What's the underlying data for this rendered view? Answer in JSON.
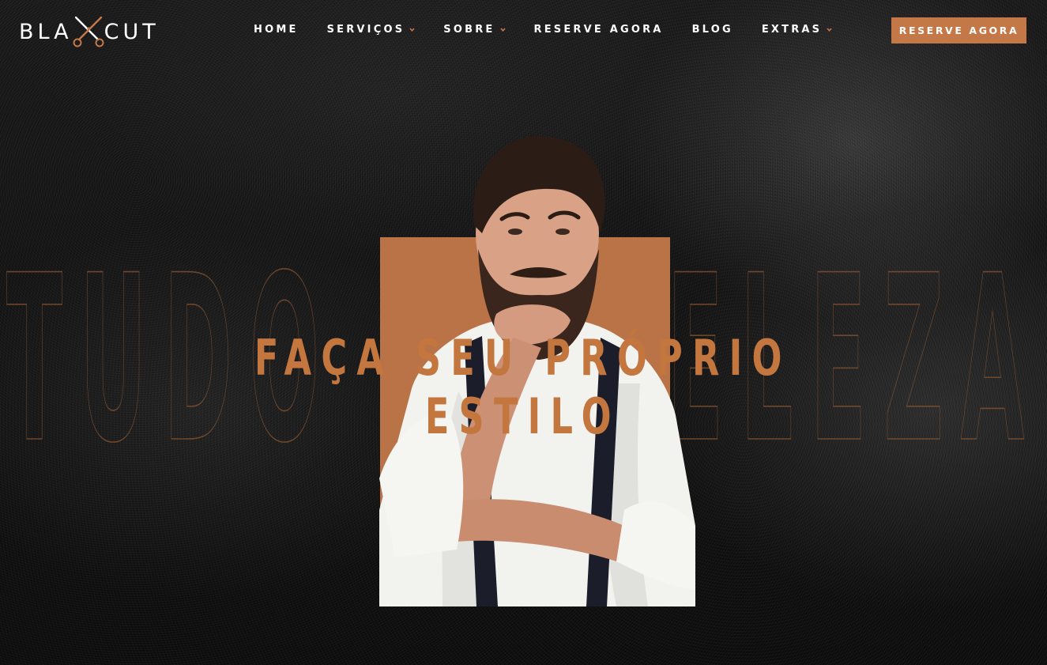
{
  "header": {
    "logo": {
      "left": "BLA",
      "right": "CUT",
      "mark_icon": "scissors-icon"
    },
    "nav": [
      {
        "label": "HOME",
        "has_dropdown": false
      },
      {
        "label": "SERVIÇOS",
        "has_dropdown": true
      },
      {
        "label": "SOBRE",
        "has_dropdown": true
      },
      {
        "label": "RESERVE AGORA",
        "has_dropdown": false
      },
      {
        "label": "BLOG",
        "has_dropdown": false
      },
      {
        "label": "EXTRAS",
        "has_dropdown": true
      }
    ],
    "cta_label": "RESERVE AGORA"
  },
  "hero": {
    "headline": "FAÇA SEU PRÓPRIO ESTILO",
    "background_word": "TUDO DE BELEZA"
  },
  "colors": {
    "accent": "#c57847",
    "accent_block": "#b97346",
    "background": "#141414",
    "text": "#ffffff"
  }
}
